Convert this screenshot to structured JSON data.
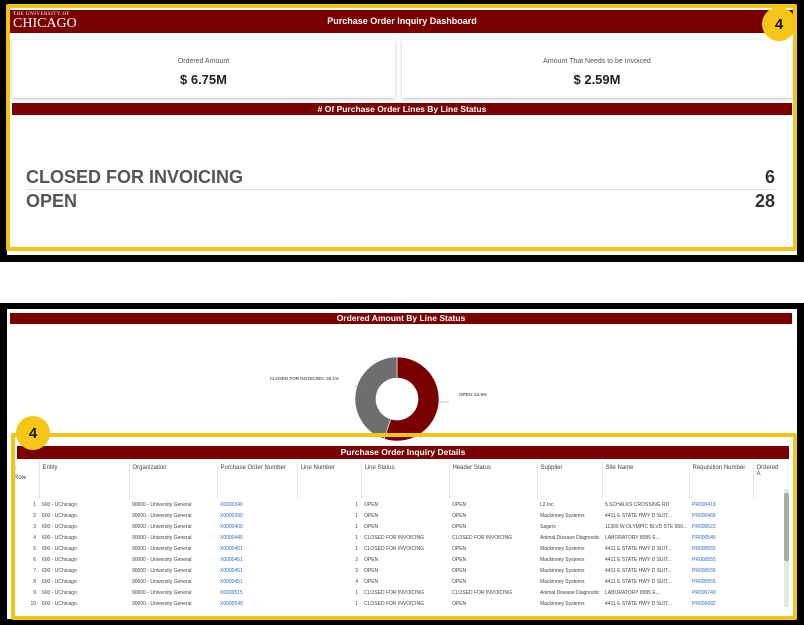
{
  "dashboard": {
    "logo_line1": "THE UNIVERSITY OF",
    "logo_line2": "CHICAGO",
    "title": "Purchase Order Inquiry Dashboard",
    "badge": "4",
    "ordered_label": "Ordered Amount",
    "ordered_value": "$ 6.75M",
    "invoice_label": "Amount That Needs to be Invoiced",
    "invoice_value": "$ 2.59M",
    "lines_title": "# Of Purchase Order Lines By Line Status",
    "status_rows": [
      {
        "label": "CLOSED FOR INVOICING",
        "count": "6"
      },
      {
        "label": "OPEN",
        "count": "28"
      }
    ]
  },
  "donut": {
    "title": "Ordered Amount By Line Status",
    "closed_label": "CLOSED FOR INVOICING: 45.1%",
    "open_label": "OPEN: 54.9%"
  },
  "chart_data": {
    "type": "pie",
    "title": "Ordered Amount By Line Status",
    "categories": [
      "OPEN",
      "CLOSED FOR INVOICING"
    ],
    "values": [
      54.9,
      45.1
    ],
    "colors": [
      "#7a0000",
      "#6e6e6e"
    ],
    "donut": true
  },
  "details": {
    "title": "Purchase Order Inquiry Details",
    "badge": "4",
    "columns": [
      "Row",
      "Entity",
      "Organization",
      "Purchase Order Number",
      "Line Number",
      "Line Status",
      "Header Status",
      "Supplier",
      "Site Name",
      "Requisition Number",
      "Ordered A"
    ],
    "rows": [
      [
        "1",
        "600 - UChicago",
        "90000 - University General",
        "X0000340",
        "1",
        "OPEN",
        "OPEN",
        "L2 Inc",
        "5 SCHALKS CROSSING RD",
        "PR000419"
      ],
      [
        "2",
        "600 - UChicago",
        "90000 - University General",
        "X0000390",
        "1",
        "OPEN",
        "OPEN",
        "Mackinney Systems",
        "4411 E STATE HWY D     SUIT...",
        "PR000468"
      ],
      [
        "3",
        "600 - UChicago",
        "90000 - University General",
        "X0000400",
        "1",
        "OPEN",
        "OPEN",
        "Sagers",
        "11300 W OLYMPIC BLVD STE 800...",
        "PR000523"
      ],
      [
        "4",
        "600 - UChicago",
        "90000 - University General",
        "X0000445",
        "1",
        "CLOSED FOR INVOICING",
        "CLOSED FOR INVOICING",
        "Animal Disease Diagnostic",
        "LABORATORY          8995 E...",
        "PR000545"
      ],
      [
        "5",
        "600 - UChicago",
        "90000 - University General",
        "X0000451",
        "1",
        "CLOSED FOR INVOICING",
        "OPEN",
        "Mackinney Systems",
        "4411 E STATE HWY D     SUIT...",
        "PR000555"
      ],
      [
        "6",
        "600 - UChicago",
        "90000 - University General",
        "X0000451",
        "2",
        "OPEN",
        "OPEN",
        "Mackinney Systems",
        "4411 E STATE HWY D     SUIT...",
        "PR000555"
      ],
      [
        "7",
        "600 - UChicago",
        "90000 - University General",
        "X0000451",
        "3",
        "OPEN",
        "OPEN",
        "Mackinney Systems",
        "4411 E STATE HWY D     SUIT...",
        "PR000555"
      ],
      [
        "8",
        "600 - UChicago",
        "90000 - University General",
        "X0000451",
        "4",
        "OPEN",
        "OPEN",
        "Mackinney Systems",
        "4411 E STATE HWY D     SUIT...",
        "PR000555"
      ],
      [
        "9",
        "600 - UChicago",
        "90000 - University General",
        "X0000515",
        "1",
        "CLOSED FOR INVOICING",
        "CLOSED FOR INVOICING",
        "Animal Disease Diagnostic",
        "LABORATORY          8995 E...",
        "PR000749"
      ],
      [
        "10",
        "600 - UChicago",
        "90000 - University General",
        "X0000549",
        "1",
        "CLOSED FOR INVOICING",
        "OPEN",
        "Mackinney Systems",
        "4411 E STATE HWY D     SUIT...",
        "PR000682"
      ]
    ]
  }
}
